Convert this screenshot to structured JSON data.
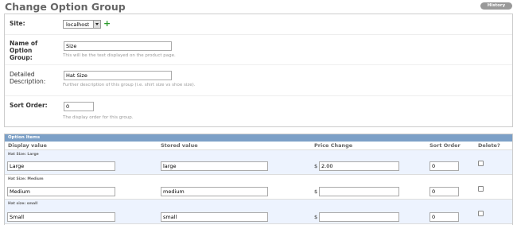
{
  "page": {
    "title": "Change Option Group",
    "history_label": "History"
  },
  "form": {
    "site": {
      "label": "Site:",
      "value": "localhost"
    },
    "name": {
      "label_lines": [
        "Name of",
        "Option",
        "Group:"
      ],
      "value": "Size",
      "help": "This will be the text displayed on the product page."
    },
    "description": {
      "label_lines": [
        "Detailed",
        "Description:"
      ],
      "value": "Hat Size",
      "help": "Further description of this group (i.e. shirt size vs shoe size)."
    },
    "sort_order": {
      "label": "Sort Order:",
      "value": "0",
      "help": "The display order for this group."
    }
  },
  "option_items": {
    "header": "Option Items",
    "columns": [
      "Display value",
      "Stored value",
      "Price Change",
      "Sort Order",
      "Delete?"
    ],
    "currency_symbol": "$",
    "rows": [
      {
        "title": "Hat Size: Large",
        "display": "Large",
        "stored": "large",
        "price": "2.00",
        "sort": "0"
      },
      {
        "title": "Hat Size: Medium",
        "display": "Medium",
        "stored": "medium",
        "price": "",
        "sort": "0"
      },
      {
        "title": "Hat size: small",
        "display": "Small",
        "stored": "small",
        "price": "",
        "sort": "0"
      }
    ]
  },
  "colors": {
    "header_bg": "#7ca0c7",
    "row_bg": "#edf3fe",
    "add_icon": "#2a9a2a"
  }
}
